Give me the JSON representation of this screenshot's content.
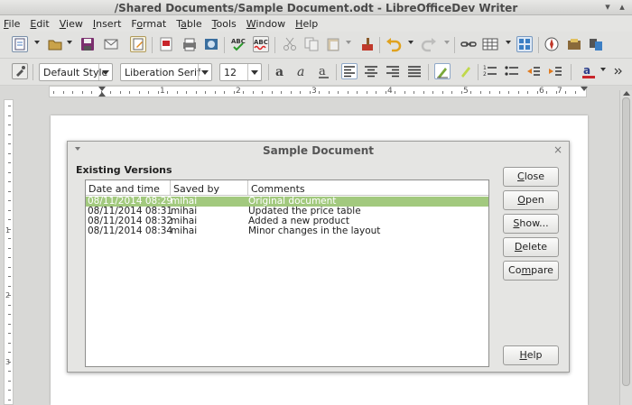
{
  "window": {
    "title": "/Shared Documents/Sample Document.odt - LibreOfficeDev Writer"
  },
  "menubar": {
    "items": [
      {
        "label": "File",
        "u": "F",
        "rest": "ile"
      },
      {
        "label": "Edit",
        "u": "E",
        "rest": "dit"
      },
      {
        "label": "View",
        "u": "V",
        "rest": "iew"
      },
      {
        "label": "Insert",
        "u": "I",
        "rest": "nsert"
      },
      {
        "label": "Format",
        "u": "o",
        "pre": "F",
        "rest": "rmat"
      },
      {
        "label": "Table",
        "u": "a",
        "pre": "T",
        "rest": "ble"
      },
      {
        "label": "Tools",
        "u": "T",
        "rest": "ools"
      },
      {
        "label": "Window",
        "u": "W",
        "rest": "indow"
      },
      {
        "label": "Help",
        "u": "H",
        "rest": "elp"
      }
    ]
  },
  "toolbar": {
    "paragraph_style": "Default Style",
    "font_name": "Liberation Serif",
    "font_size": "12"
  },
  "ruler": {
    "numbers": [
      "1",
      "2",
      "3",
      "4",
      "5",
      "6",
      "7"
    ]
  },
  "vruler": {
    "numbers": [
      "1",
      "2",
      "3"
    ]
  },
  "dialog": {
    "title": "Sample Document",
    "section_label": "Existing Versions",
    "columns": [
      "Date and time",
      "Saved by",
      "Comments"
    ],
    "rows": [
      {
        "date": "08/11/2014 08:29",
        "by": "mihai",
        "comment": "Original document",
        "selected": true
      },
      {
        "date": "08/11/2014 08:31",
        "by": "mihai",
        "comment": "Updated the price table",
        "selected": false
      },
      {
        "date": "08/11/2014 08:32",
        "by": "mihai",
        "comment": "Added a new product",
        "selected": false
      },
      {
        "date": "08/11/2014 08:34",
        "by": "mihai",
        "comment": "Minor changes in the layout",
        "selected": false
      }
    ],
    "buttons": {
      "close": {
        "u": "C",
        "rest": "lose"
      },
      "open": {
        "u": "O",
        "rest": "pen"
      },
      "show": {
        "u": "S",
        "rest": "how..."
      },
      "delete": {
        "u": "D",
        "rest": "elete"
      },
      "compare": {
        "u": "m",
        "pre": "Co",
        "rest": "pare"
      },
      "help": {
        "u": "H",
        "rest": "elp"
      }
    }
  },
  "colors": {
    "selection": "#a2c97e",
    "accent": "#3c7fc4"
  }
}
